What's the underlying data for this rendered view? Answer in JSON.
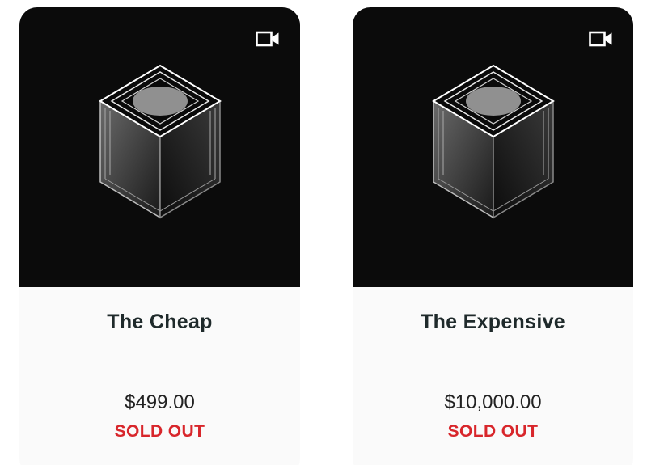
{
  "products": [
    {
      "name": "The Cheap",
      "price": "$499.00",
      "status": "SOLD OUT",
      "media_icon": "video-camera-icon",
      "image": "glowing-glass-cube"
    },
    {
      "name": "The Expensive",
      "price": "$10,000.00",
      "status": "SOLD OUT",
      "media_icon": "video-camera-icon",
      "image": "glowing-glass-cube"
    }
  ],
  "colors": {
    "media_background": "#0b0b0b",
    "card_background": "#fafafa",
    "title": "#1f2a2b",
    "status": "#d8262b"
  }
}
